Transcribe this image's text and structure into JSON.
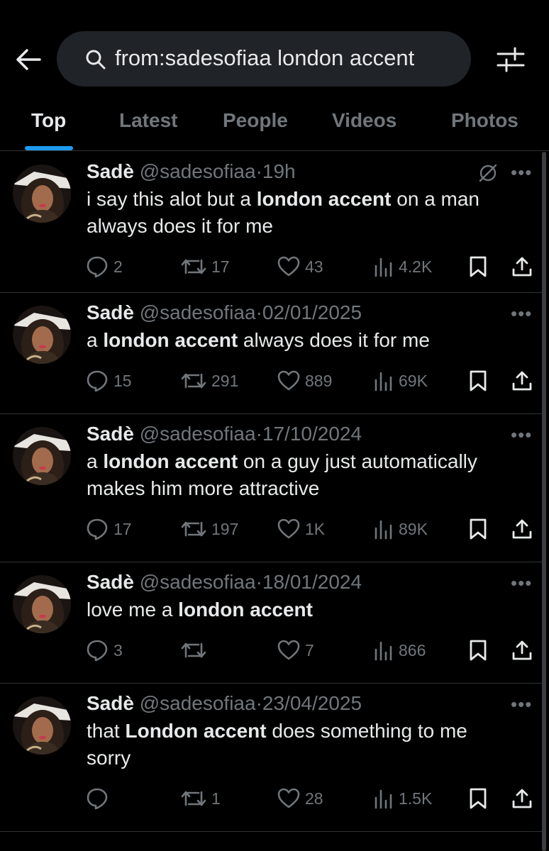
{
  "search": {
    "query": "from:sadesofiaa london accent"
  },
  "tabs": [
    "Top",
    "Latest",
    "People",
    "Videos",
    "Photos"
  ],
  "tweets": [
    {
      "name": "Sadè",
      "handle": "@sadesofiaa",
      "sep": "·",
      "time": "19h",
      "text_parts": [
        "i say this alot but a ",
        "london accent",
        " on a man always does it for me"
      ],
      "replies": "2",
      "retweets": "17",
      "likes": "43",
      "views": "4.2K"
    },
    {
      "name": "Sadè",
      "handle": "@sadesofiaa",
      "sep": "·",
      "time": "02/01/2025",
      "text_parts": [
        "a ",
        "london accent",
        " always does it for me"
      ],
      "replies": "15",
      "retweets": "291",
      "likes": "889",
      "views": "69K"
    },
    {
      "name": "Sadè",
      "handle": "@sadesofiaa",
      "sep": "·",
      "time": "17/10/2024",
      "text_parts": [
        "a ",
        "london accent",
        " on a guy just automatically makes him more attractive"
      ],
      "replies": "17",
      "retweets": "197",
      "likes": "1K",
      "views": "89K"
    },
    {
      "name": "Sadè",
      "handle": "@sadesofiaa",
      "sep": "·",
      "time": "18/01/2024",
      "text_parts": [
        "love me a ",
        "london accent",
        ""
      ],
      "replies": "3",
      "retweets": "",
      "likes": "7",
      "views": "866"
    },
    {
      "name": "Sadè",
      "handle": "@sadesofiaa",
      "sep": "·",
      "time": "23/04/2025",
      "text_parts": [
        "that ",
        "London accent",
        " does something to me sorry"
      ],
      "replies": "",
      "retweets": "1",
      "likes": "28",
      "views": "1.5K"
    }
  ],
  "more_label": "•••",
  "icons": {
    "back": "arrow-left-icon",
    "search": "search-icon",
    "filter": "filter-icon",
    "reply": "reply-icon",
    "retweet": "retweet-icon",
    "like": "heart-icon",
    "views": "views-icon",
    "bookmark": "bookmark-icon",
    "share": "share-icon",
    "more": "more-icon",
    "mute": "mute-icon"
  },
  "colors": {
    "accent": "#1d9bf0",
    "text": "#e7e9ea",
    "muted": "#71767b",
    "background": "#000000",
    "search_bg": "#202327"
  }
}
